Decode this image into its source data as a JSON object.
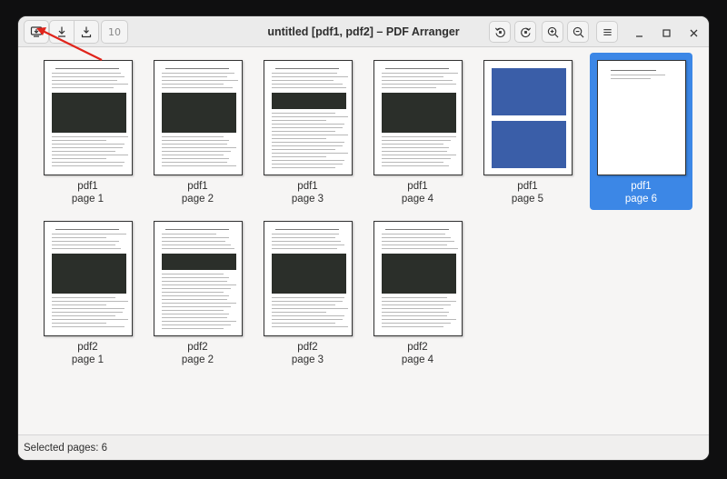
{
  "window": {
    "title": "untitled [pdf1, pdf2] – PDF Arranger",
    "page_field_value": "10"
  },
  "toolbar": {
    "left_icons": [
      "import-icon",
      "save-icon",
      "save-as-icon"
    ],
    "right_icons": [
      "rotate-left-icon",
      "rotate-right-icon",
      "zoom-in-icon",
      "zoom-out-icon",
      "menu-icon"
    ],
    "window_controls": [
      "minimize-icon",
      "maximize-icon",
      "close-icon"
    ]
  },
  "pages": [
    {
      "doc": "pdf1",
      "label": "page 1",
      "selected": false,
      "kind": "article-screenshot"
    },
    {
      "doc": "pdf1",
      "label": "page 2",
      "selected": false,
      "kind": "article-screenshot"
    },
    {
      "doc": "pdf1",
      "label": "page 3",
      "selected": false,
      "kind": "article-code"
    },
    {
      "doc": "pdf1",
      "label": "page 4",
      "selected": false,
      "kind": "article-screenshot"
    },
    {
      "doc": "pdf1",
      "label": "page 5",
      "selected": false,
      "kind": "screenshots"
    },
    {
      "doc": "pdf1",
      "label": "page 6",
      "selected": true,
      "kind": "short"
    },
    {
      "doc": "pdf2",
      "label": "page 1",
      "selected": false,
      "kind": "article-screenshot"
    },
    {
      "doc": "pdf2",
      "label": "page 2",
      "selected": false,
      "kind": "article-code"
    },
    {
      "doc": "pdf2",
      "label": "page 3",
      "selected": false,
      "kind": "article-screenshot"
    },
    {
      "doc": "pdf2",
      "label": "page 4",
      "selected": false,
      "kind": "article-screenshot"
    }
  ],
  "status": {
    "text": "Selected pages: 6"
  },
  "colors": {
    "selection": "#3c87e6",
    "annotation_arrow": "#e0241b"
  }
}
